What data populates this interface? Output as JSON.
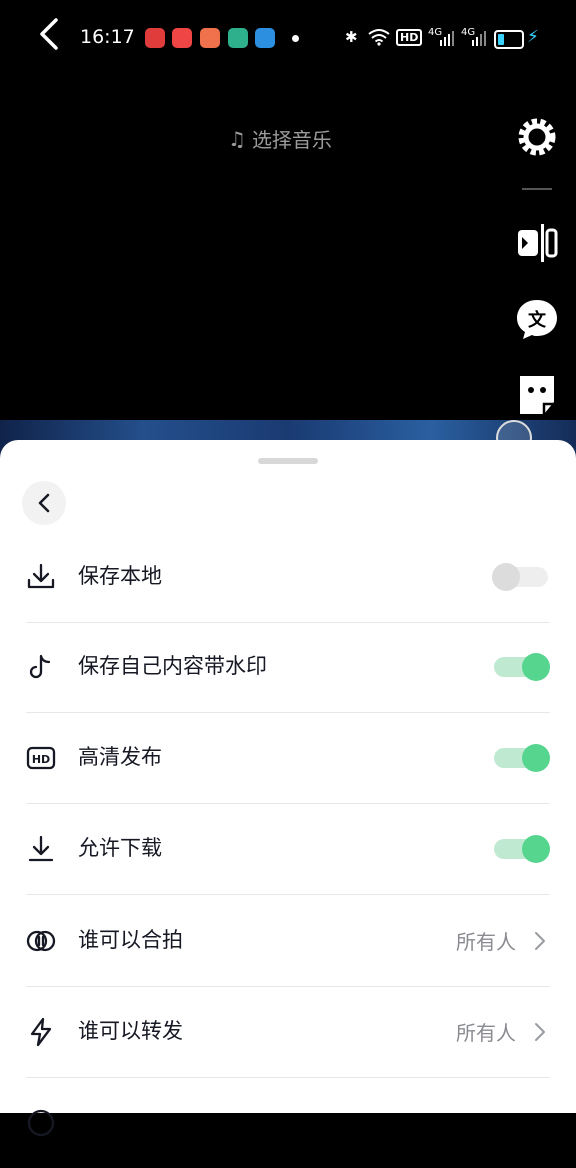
{
  "status_bar": {
    "time": "16:17",
    "network_label": "HD",
    "signal1_label": "4G",
    "signal2_label": "4G",
    "battery_color": "#3ad1ff"
  },
  "header": {
    "music_label": "选择音乐"
  },
  "right_toolbar": {
    "icons": [
      "gear-icon",
      "flip-icon",
      "text-icon",
      "sticker-icon"
    ]
  },
  "settings": {
    "rows": [
      {
        "icon": "download-icon",
        "label": "保存本地",
        "type": "toggle",
        "on": false
      },
      {
        "icon": "tiktok-icon",
        "label": "保存自己内容带水印",
        "type": "toggle",
        "on": true
      },
      {
        "icon": "hd-icon",
        "label": "高清发布",
        "type": "toggle",
        "on": true
      },
      {
        "icon": "download-arrow-icon",
        "label": "允许下载",
        "type": "toggle",
        "on": true
      },
      {
        "icon": "duet-icon",
        "label": "谁可以合拍",
        "type": "select",
        "value": "所有人"
      },
      {
        "icon": "lightning-icon",
        "label": "谁可以转发",
        "type": "select",
        "value": "所有人"
      }
    ]
  },
  "colors": {
    "toggle_on": "#56d58f",
    "toggle_on_track": "#bfe9d1",
    "toggle_off": "#dcdcdc"
  }
}
